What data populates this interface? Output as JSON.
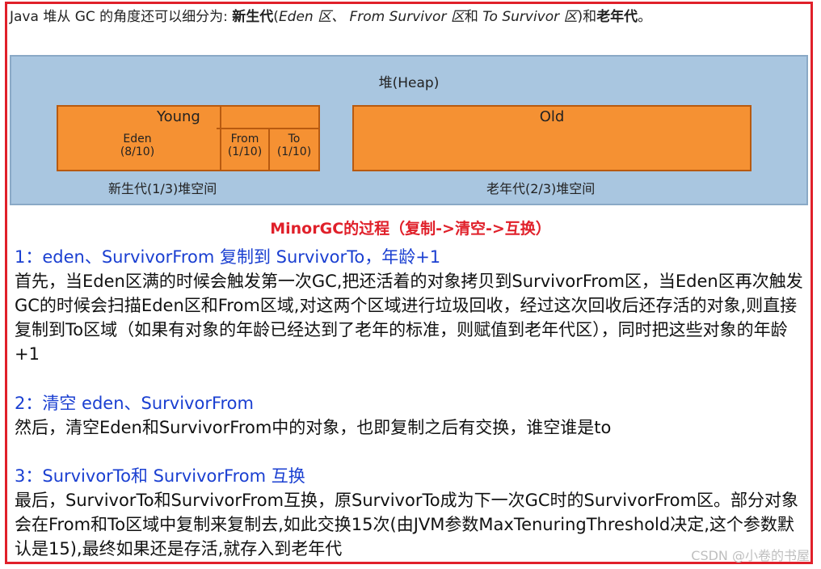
{
  "intro": {
    "p1": "Java 堆从 GC 的角度还可以细分为: ",
    "b1": "新生代",
    "p2": "(",
    "i1": "Eden 区、 From Survivor 区",
    "p3": "和 ",
    "i2": "To Survivor 区",
    "p4": ")和",
    "b2": "老年代",
    "p5": "。"
  },
  "diagram": {
    "heap_title": "堆(Heap)",
    "young_label": "Young",
    "old_label": "Old",
    "eden": "Eden",
    "eden_ratio": "(8/10)",
    "from": "From",
    "from_ratio": "(1/10)",
    "to": "To",
    "to_ratio": "(1/10)",
    "young_caption": "新生代(1/3)堆空间",
    "old_caption": "老年代(2/3)堆空间"
  },
  "title": "MinorGC的过程（复制->清空->互换）",
  "steps": [
    {
      "heading": "1：eden、SurvivorFrom 复制到 SurvivorTo，年龄+1",
      "body": "首先，当Eden区满的时候会触发第一次GC,把还活着的对象拷贝到SurvivorFrom区，当Eden区再次触发GC的时候会扫描Eden区和From区域,对这两个区域进行垃圾回收，经过这次回收后还存活的对象,则直接复制到To区域（如果有对象的年龄已经达到了老年的标准，则赋值到老年代区），同时把这些对象的年龄+1"
    },
    {
      "heading": "2：清空 eden、SurvivorFrom",
      "body": "然后，清空Eden和SurvivorFrom中的对象，也即复制之后有交换，谁空谁是to"
    },
    {
      "heading": "3：SurvivorTo和 SurvivorFrom 互换",
      "body": "最后，SurvivorTo和SurvivorFrom互换，原SurvivorTo成为下一次GC时的SurvivorFrom区。部分对象会在From和To区域中复制来复制去,如此交换15次(由JVM参数MaxTenuringThreshold决定,这个参数默认是15),最终如果还是存活,就存入到老年代"
    }
  ],
  "watermark": "CSDN @小卷的书屋"
}
